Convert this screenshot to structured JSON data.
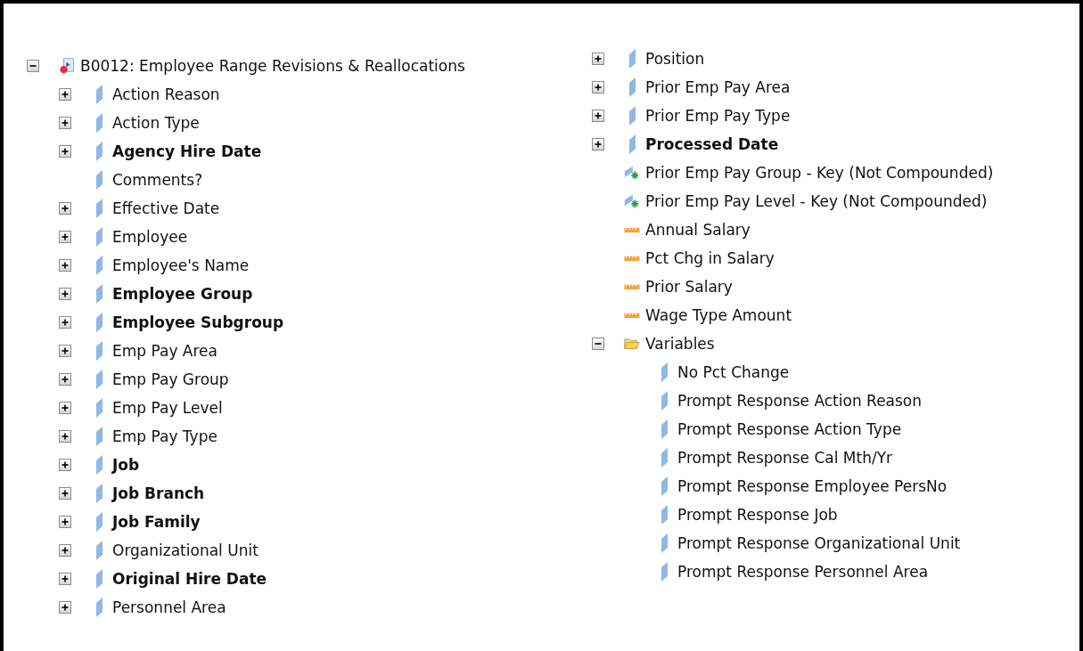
{
  "root": {
    "label": "B0012: Employee Range Revisions & Reallocations",
    "kind": "query",
    "expanded": true,
    "children": [
      {
        "label": "Action Reason",
        "kind": "dimension",
        "bold": false,
        "expanded": false
      },
      {
        "label": "Action Type",
        "kind": "dimension",
        "bold": false,
        "expanded": false
      },
      {
        "label": "Agency Hire Date",
        "kind": "dimension",
        "bold": true,
        "expanded": false
      },
      {
        "label": "Comments?",
        "kind": "dimension",
        "bold": false
      },
      {
        "label": "Effective Date",
        "kind": "dimension",
        "bold": false,
        "expanded": false
      },
      {
        "label": "Employee",
        "kind": "dimension",
        "bold": false,
        "expanded": false
      },
      {
        "label": "Employee's Name",
        "kind": "dimension",
        "bold": false,
        "expanded": false
      },
      {
        "label": "Employee Group",
        "kind": "dimension",
        "bold": true,
        "expanded": false
      },
      {
        "label": "Employee Subgroup",
        "kind": "dimension",
        "bold": true,
        "expanded": false
      },
      {
        "label": "Emp Pay Area",
        "kind": "dimension",
        "bold": false,
        "expanded": false
      },
      {
        "label": "Emp Pay Group",
        "kind": "dimension",
        "bold": false,
        "expanded": false
      },
      {
        "label": "Emp Pay Level",
        "kind": "dimension",
        "bold": false,
        "expanded": false
      },
      {
        "label": "Emp Pay Type",
        "kind": "dimension",
        "bold": false,
        "expanded": false
      },
      {
        "label": "Job",
        "kind": "dimension",
        "bold": true,
        "expanded": false
      },
      {
        "label": "Job Branch",
        "kind": "dimension",
        "bold": true,
        "expanded": false
      },
      {
        "label": "Job Family",
        "kind": "dimension",
        "bold": true,
        "expanded": false
      },
      {
        "label": "Organizational Unit",
        "kind": "dimension",
        "bold": false,
        "expanded": false
      },
      {
        "label": "Original Hire Date",
        "kind": "dimension",
        "bold": true,
        "expanded": false
      },
      {
        "label": "Personnel Area",
        "kind": "dimension",
        "bold": false,
        "expanded": false
      }
    ]
  },
  "root_children_continued": [
    {
      "label": "Position",
      "kind": "dimension",
      "bold": false,
      "expanded": false
    },
    {
      "label": "Prior Emp Pay Area",
      "kind": "dimension",
      "bold": false,
      "expanded": false
    },
    {
      "label": "Prior Emp Pay Type",
      "kind": "dimension",
      "bold": false,
      "expanded": false
    },
    {
      "label": "Processed Date",
      "kind": "dimension",
      "bold": true,
      "expanded": false
    },
    {
      "label": "Prior Emp Pay Group - Key (Not Compounded)",
      "kind": "key",
      "bold": false
    },
    {
      "label": "Prior Emp Pay Level - Key (Not Compounded)",
      "kind": "key",
      "bold": false
    },
    {
      "label": "Annual Salary",
      "kind": "measure",
      "bold": false
    },
    {
      "label": "Pct Chg in Salary",
      "kind": "measure",
      "bold": false
    },
    {
      "label": "Prior Salary",
      "kind": "measure",
      "bold": false
    },
    {
      "label": "Wage Type Amount",
      "kind": "measure",
      "bold": false
    },
    {
      "label": "Variables",
      "kind": "folder",
      "bold": false,
      "expanded": true,
      "children": [
        {
          "label": "No Pct Change",
          "kind": "dimension",
          "bold": false
        },
        {
          "label": "Prompt Response Action Reason",
          "kind": "dimension",
          "bold": false
        },
        {
          "label": "Prompt Response Action Type",
          "kind": "dimension",
          "bold": false
        },
        {
          "label": "Prompt Response Cal Mth/Yr",
          "kind": "dimension",
          "bold": false
        },
        {
          "label": "Prompt Response Employee PersNo",
          "kind": "dimension",
          "bold": false
        },
        {
          "label": "Prompt Response Job",
          "kind": "dimension",
          "bold": false
        },
        {
          "label": "Prompt Response Organizational Unit",
          "kind": "dimension",
          "bold": false
        },
        {
          "label": "Prompt Response Personnel Area",
          "kind": "dimension",
          "bold": false
        }
      ]
    }
  ]
}
